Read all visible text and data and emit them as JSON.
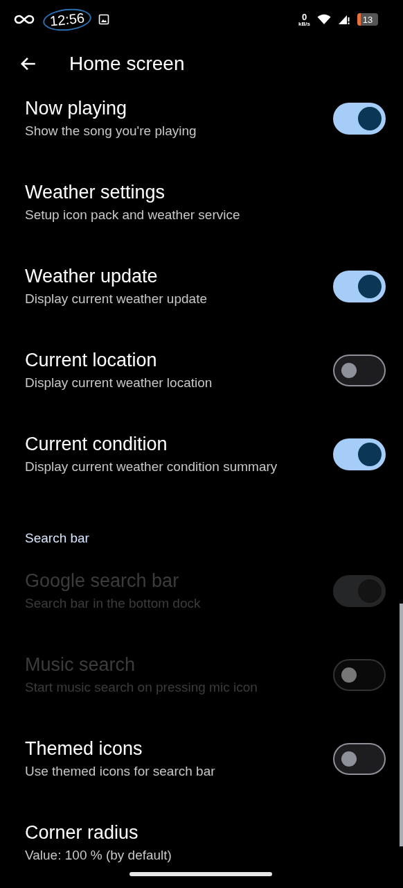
{
  "status_bar": {
    "time": "12:56",
    "net_speed": "0",
    "net_speed_unit": "kB/s",
    "battery": "13"
  },
  "toolbar": {
    "title": "Home screen"
  },
  "items": [
    {
      "kind": "switch",
      "title": "Now playing",
      "summary": "Show the song you're playing",
      "on": true,
      "disabled": false
    },
    {
      "kind": "plain",
      "title": "Weather settings",
      "summary": "Setup icon pack and weather service",
      "disabled": false
    },
    {
      "kind": "switch",
      "title": "Weather update",
      "summary": "Display current weather update",
      "on": true,
      "disabled": false
    },
    {
      "kind": "switch",
      "title": "Current location",
      "summary": "Display current weather location",
      "on": false,
      "disabled": false
    },
    {
      "kind": "switch",
      "title": "Current condition",
      "summary": "Display current weather condition summary",
      "on": true,
      "disabled": false
    },
    {
      "kind": "header",
      "title": "Search bar"
    },
    {
      "kind": "switch",
      "title": "Google search bar",
      "summary": "Search bar in the bottom dock",
      "on": true,
      "disabled": true
    },
    {
      "kind": "switch",
      "title": "Music search",
      "summary": "Start music search on pressing mic icon",
      "on": false,
      "disabled": true
    },
    {
      "kind": "switch",
      "title": "Themed icons",
      "summary": "Use themed icons for search bar",
      "on": false,
      "disabled": false
    },
    {
      "kind": "plain",
      "title": "Corner radius",
      "summary": "Value: 100 % (by default)",
      "disabled": false
    }
  ]
}
